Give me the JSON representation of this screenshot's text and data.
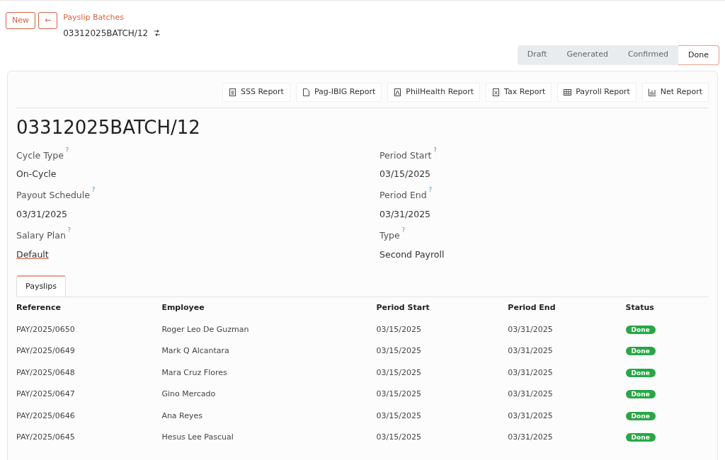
{
  "header": {
    "new_button": "New",
    "back_button": "←",
    "breadcrumb": "Payslip Batches",
    "record_name": "03312025BATCH/12"
  },
  "status_steps": [
    {
      "label": "Draft",
      "selected": false
    },
    {
      "label": "Generated",
      "selected": false
    },
    {
      "label": "Confirmed",
      "selected": false
    },
    {
      "label": "Done",
      "selected": true
    }
  ],
  "report_buttons": [
    {
      "label": "SSS Report",
      "kind": "doc"
    },
    {
      "label": "Pag-IBIG Report",
      "kind": "file"
    },
    {
      "label": "PhilHealth Report",
      "kind": "pdf"
    },
    {
      "label": "Tax Report",
      "kind": "excel"
    },
    {
      "label": "Payroll Report",
      "kind": "table"
    },
    {
      "label": "Net Report",
      "kind": "chart"
    }
  ],
  "title": "03312025BATCH/12",
  "fields_left": [
    {
      "label": "Cycle Type",
      "help": "?",
      "value": "On-Cycle",
      "kind": "text"
    },
    {
      "label": "Payout Schedule",
      "help": "?",
      "value": "03/31/2025",
      "kind": "text"
    },
    {
      "label": "Salary Plan",
      "help": "?",
      "value": "Default",
      "kind": "link"
    }
  ],
  "fields_right": [
    {
      "label": "Period Start",
      "help": "?",
      "value": "03/15/2025"
    },
    {
      "label": "Period End",
      "help": "?",
      "value": "03/31/2025"
    },
    {
      "label": "Type",
      "help": "?",
      "value": "Second Payroll"
    }
  ],
  "tabs": [
    {
      "label": "Payslips",
      "selected": true
    }
  ],
  "table": {
    "columns": [
      "Reference",
      "Employee",
      "Period Start",
      "Period End",
      "Status"
    ],
    "rows": [
      {
        "reference": "PAY/2025/0650",
        "employee": "Roger Leo De Guzman",
        "period_start": "03/15/2025",
        "period_end": "03/31/2025",
        "status": "Done"
      },
      {
        "reference": "PAY/2025/0649",
        "employee": "Mark Q Alcantara",
        "period_start": "03/15/2025",
        "period_end": "03/31/2025",
        "status": "Done"
      },
      {
        "reference": "PAY/2025/0648",
        "employee": "Mara Cruz Flores",
        "period_start": "03/15/2025",
        "period_end": "03/31/2025",
        "status": "Done"
      },
      {
        "reference": "PAY/2025/0647",
        "employee": "Gino Mercado",
        "period_start": "03/15/2025",
        "period_end": "03/31/2025",
        "status": "Done"
      },
      {
        "reference": "PAY/2025/0646",
        "employee": "Ana Reyes",
        "period_start": "03/15/2025",
        "period_end": "03/31/2025",
        "status": "Done"
      },
      {
        "reference": "PAY/2025/0645",
        "employee": "Hesus Lee Pascual",
        "period_start": "03/15/2025",
        "period_end": "03/31/2025",
        "status": "Done"
      }
    ]
  }
}
